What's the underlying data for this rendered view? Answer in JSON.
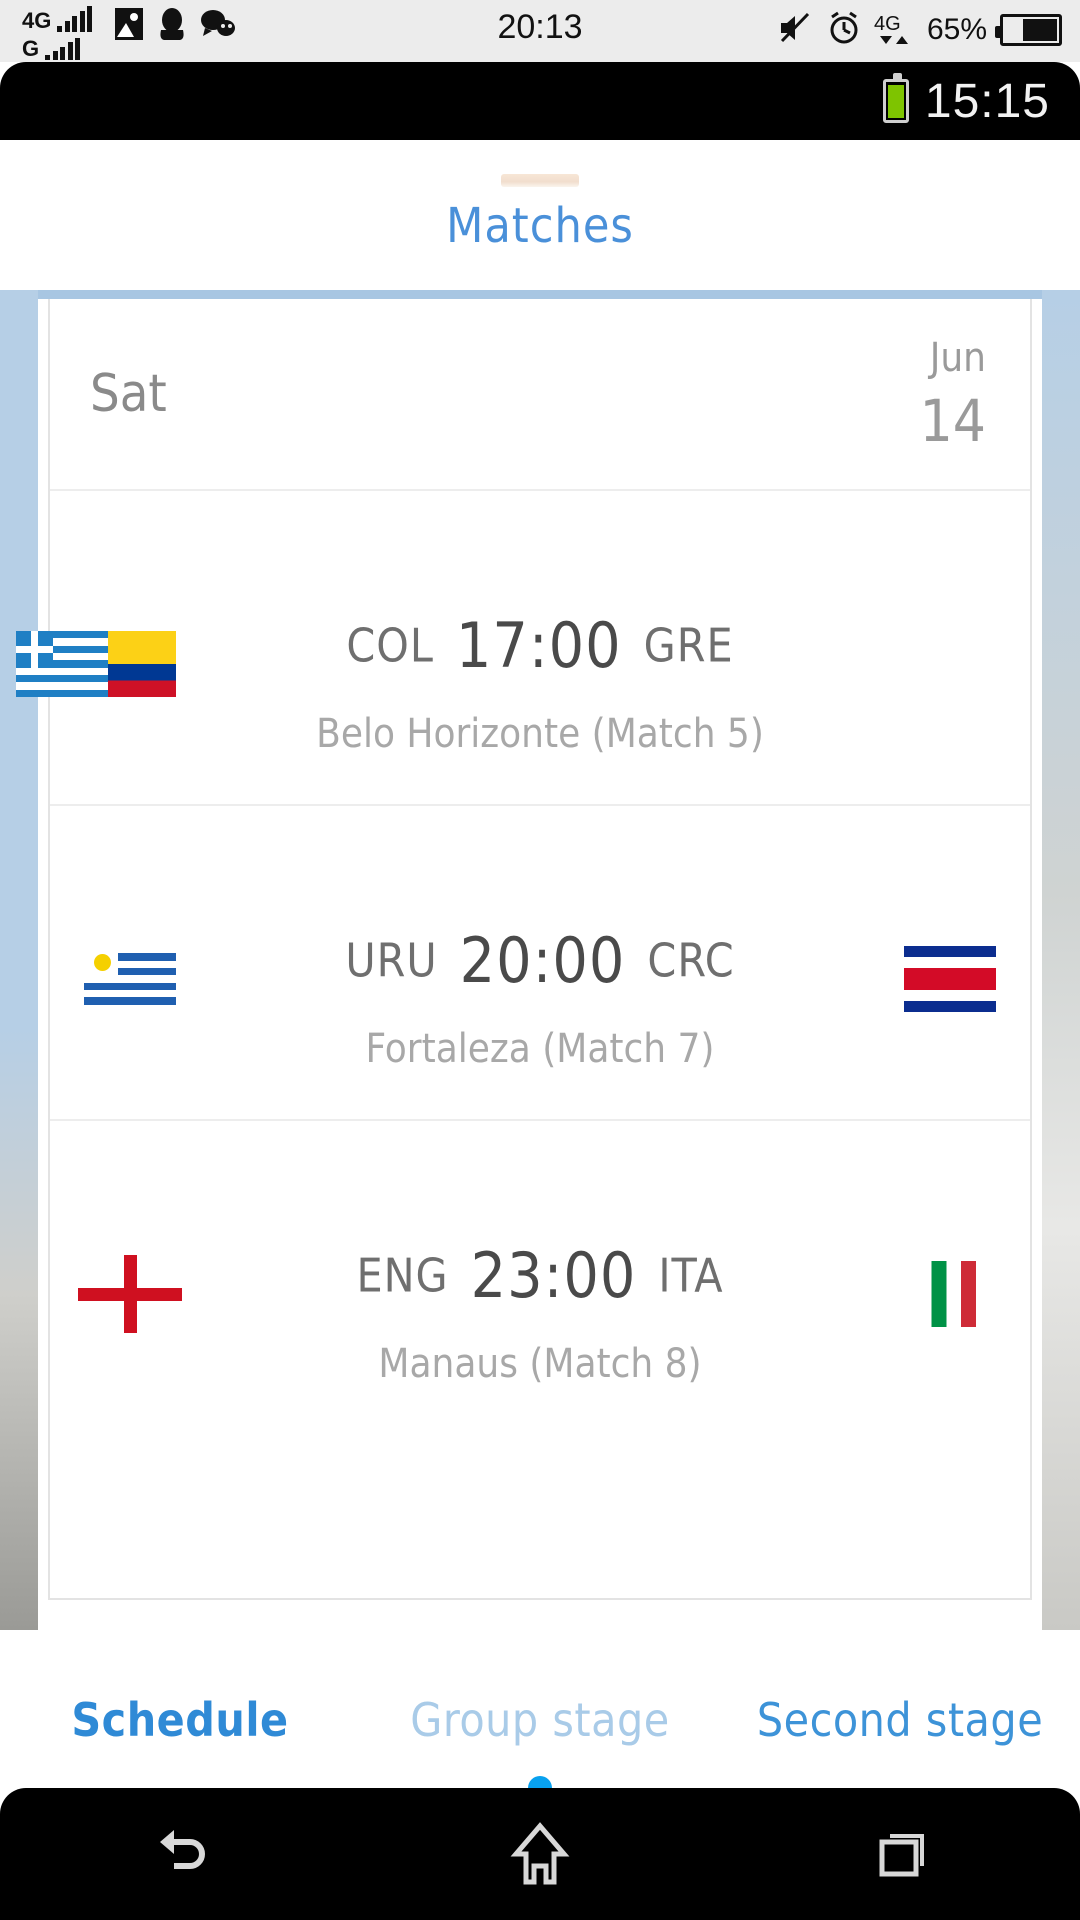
{
  "host_status": {
    "net_primary": "4G",
    "net_secondary": "G",
    "clock": "20:13",
    "battery_percent": "65%",
    "icons": [
      "photo-icon",
      "penguin-icon",
      "chat-icon",
      "mute-icon",
      "alarm-icon",
      "4g-data-icon"
    ]
  },
  "device_status": {
    "clock": "15:15",
    "battery_icon": "battery-full-icon"
  },
  "header": {
    "title": "Matches"
  },
  "schedule": {
    "date": {
      "day_of_week": "Sat",
      "month": "Jun",
      "day": "14"
    },
    "matches": [
      {
        "home_code": "COL",
        "home_flag": "colombia-flag",
        "time": "17:00",
        "away_code": "GRE",
        "away_flag": "greece-flag",
        "venue": "Belo Horizonte (Match  5)"
      },
      {
        "home_code": "URU",
        "home_flag": "uruguay-flag",
        "time": "20:00",
        "away_code": "CRC",
        "away_flag": "costa-rica-flag",
        "venue": "Fortaleza (Match  7)"
      },
      {
        "home_code": "ENG",
        "home_flag": "england-flag",
        "time": "23:00",
        "away_code": "ITA",
        "away_flag": "italy-flag",
        "venue": "Manaus (Match  8)"
      }
    ]
  },
  "tabs": [
    {
      "label": "Schedule",
      "state": "active"
    },
    {
      "label": "Group stage",
      "state": "dim"
    },
    {
      "label": "Second stage",
      "state": "normal"
    }
  ],
  "navbar": {
    "back": "back-icon",
    "home": "home-icon",
    "recents": "recents-icon"
  },
  "colors": {
    "accent": "#2f8ad6",
    "title": "#4a90d9",
    "rule": "#a8c6e2",
    "dot": "#08a1ef",
    "battery_green": "#7ec400"
  }
}
